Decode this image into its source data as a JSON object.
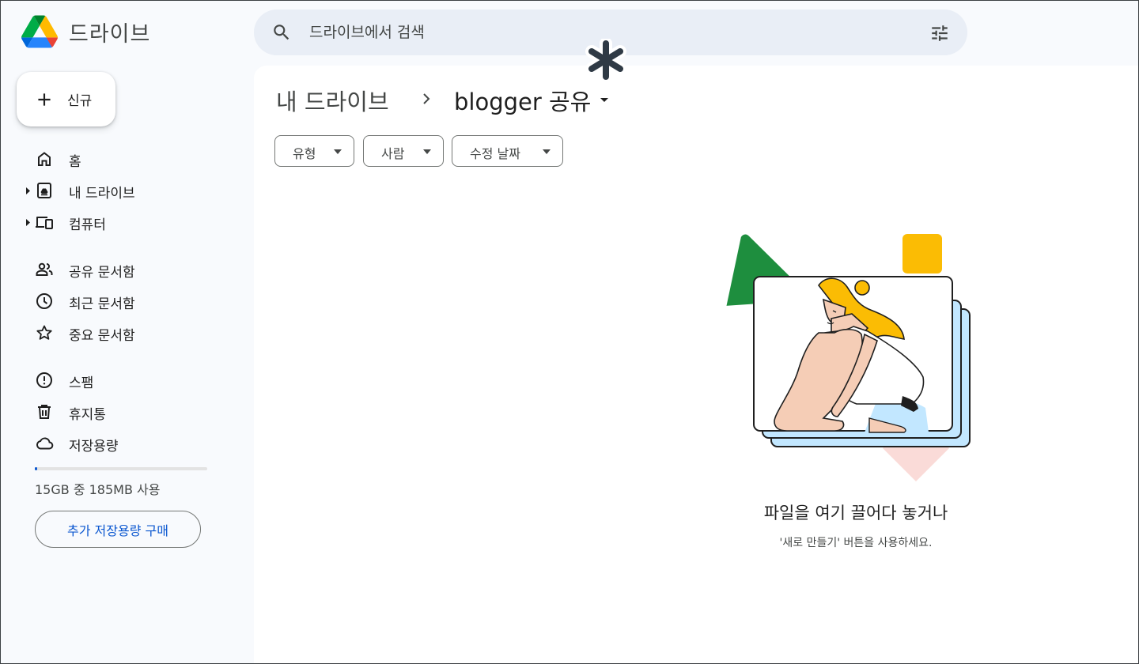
{
  "app": {
    "name": "드라이브"
  },
  "search": {
    "placeholder": "드라이브에서 검색"
  },
  "sidebar": {
    "new_label": "신규",
    "items": [
      {
        "label": "홈",
        "icon": "home-icon",
        "expandable": false
      },
      {
        "label": "내 드라이브",
        "icon": "my-drive-icon",
        "expandable": true
      },
      {
        "label": "컴퓨터",
        "icon": "computers-icon",
        "expandable": true
      },
      {
        "label": "공유 문서함",
        "icon": "shared-icon",
        "expandable": false
      },
      {
        "label": "최근 문서함",
        "icon": "clock-icon",
        "expandable": false
      },
      {
        "label": "중요 문서함",
        "icon": "star-icon",
        "expandable": false
      },
      {
        "label": "스팸",
        "icon": "spam-icon",
        "expandable": false
      },
      {
        "label": "휴지통",
        "icon": "trash-icon",
        "expandable": false
      },
      {
        "label": "저장용량",
        "icon": "cloud-icon",
        "expandable": false
      }
    ],
    "storage": {
      "text": "15GB 중 185MB 사용",
      "used_fraction": 0.012
    },
    "buy_label": "추가 저장용량 구매"
  },
  "breadcrumb": {
    "root": "내 드라이브",
    "current": "blogger 공유"
  },
  "filters": [
    {
      "label": "유형"
    },
    {
      "label": "사람"
    },
    {
      "label": "수정 날짜"
    }
  ],
  "empty_state": {
    "title": "파일을 여기 끌어다 놓거나",
    "subtitle": "'새로 만들기' 버튼을 사용하세요."
  },
  "colors": {
    "accent": "#0b57d0",
    "search_bg": "#e9eef6",
    "page_bg": "#f8fafd",
    "green": "#1e8e3e",
    "yellow": "#fbbc04",
    "light_blue": "#c2e7ff",
    "pink": "#fadbd8"
  }
}
